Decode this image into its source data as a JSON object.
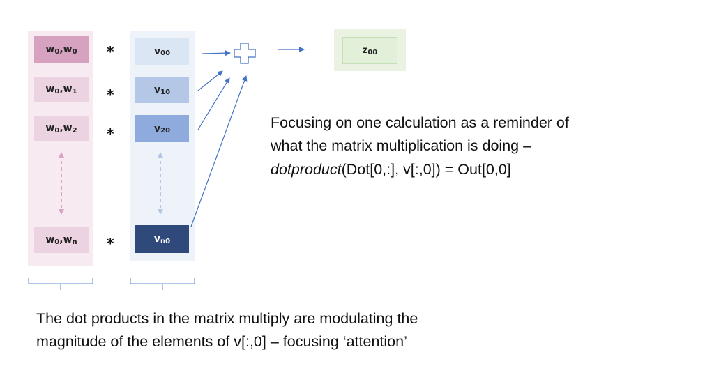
{
  "w_column": {
    "rows": [
      {
        "a": "w",
        "as": "0",
        "b": "w",
        "bs": "0"
      },
      {
        "a": "w",
        "as": "0",
        "b": "w",
        "bs": "1"
      },
      {
        "a": "w",
        "as": "0",
        "b": "w",
        "bs": "2"
      },
      {
        "a": "w",
        "as": "0",
        "b": "w",
        "bs": "n"
      }
    ]
  },
  "v_column": {
    "rows": [
      {
        "a": "v",
        "as": "00"
      },
      {
        "a": "v",
        "as": "10"
      },
      {
        "a": "v",
        "as": "20"
      },
      {
        "a": "v",
        "as": "n0"
      }
    ]
  },
  "multiply_symbol": "*",
  "output": {
    "a": "z",
    "as": "00"
  },
  "annotation": {
    "line1": "Focusing on one calculation as a reminder of",
    "line2": "what the matrix multiplication is doing –",
    "line3_italic": "dotproduct",
    "line3_rest": "(Dot[0,:], v[:,0]) = Out[0,0]"
  },
  "caption": {
    "line1": "The dot products in the matrix multiply are modulating the",
    "line2": "magnitude of the elements of v[:,0] – focusing ‘attention’"
  },
  "colors": {
    "w_panel": "#f7eaf1",
    "w_cell_0": "#d6a2bf",
    "w_cell_light": "#ecd3e1",
    "w_arrow": "#dca4c4",
    "v_panel": "#eef3fa",
    "v_cell_0": "#dbe6f4",
    "v_cell_1": "#b4c7e7",
    "v_cell_2": "#8faadc",
    "v_cell_n": "#2f4a7a",
    "v_arrow": "#b4c7e7",
    "z_panel": "#eaf3e2",
    "z_cell": "#e2f0d9",
    "z_cell_border": "#c5e0b4",
    "connector": "#4472c4",
    "bracket": "#5b8bd0"
  }
}
